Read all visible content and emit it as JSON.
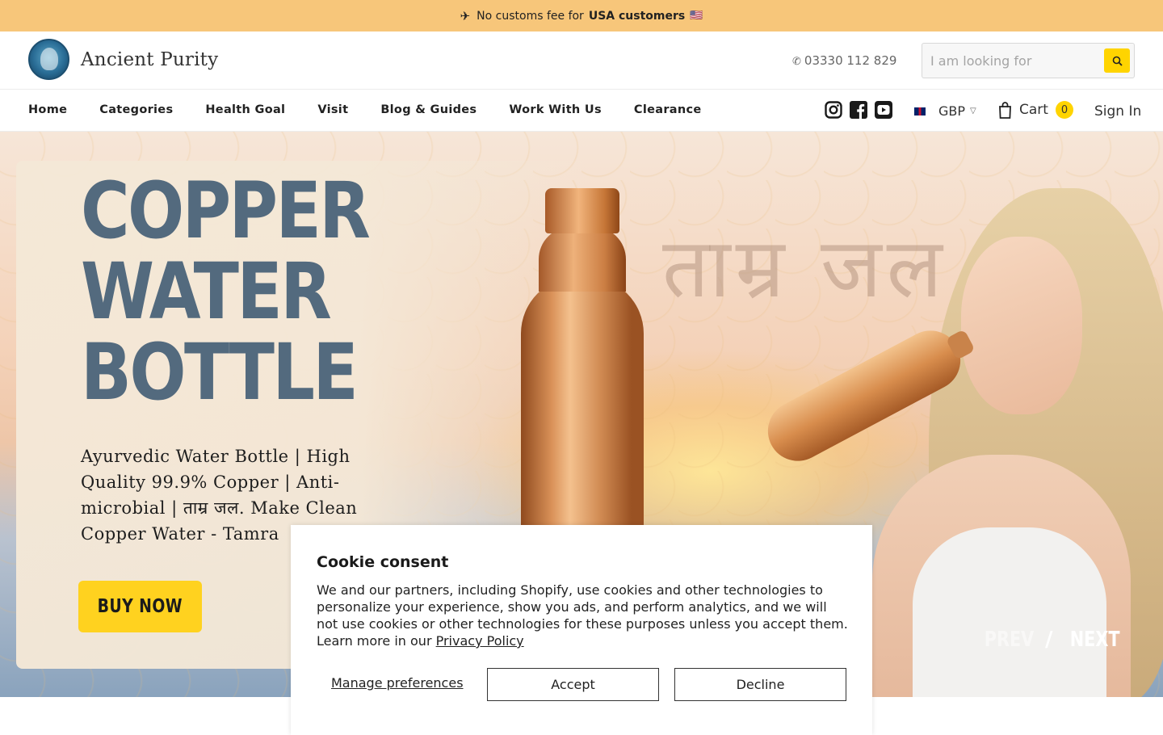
{
  "announcement": {
    "text": "No customs fee for",
    "emphasis": "USA customers",
    "flag": "🇺🇸",
    "icon": "plane-icon"
  },
  "header": {
    "logo_text": "Ancient Purity",
    "phone": "03330 112 829",
    "search_placeholder": "I am looking for"
  },
  "nav": {
    "items": [
      "Home",
      "Categories",
      "Health Goal",
      "Visit",
      "Blog & Guides",
      "Work With Us",
      "Clearance"
    ],
    "currency": "GBP",
    "cart_label": "Cart",
    "cart_count": "0",
    "signin": "Sign In"
  },
  "hero": {
    "title_line1": "COPPER",
    "title_line2": "WATER",
    "title_line3": "BOTTLE",
    "devanagari": "ताम्र जल",
    "subtitle": "Ayurvedic Water Bottle | High Quality 99.9% Copper | Anti-microbial | ताम्र जल. Make Clean Copper Water - Tamra",
    "buy_label": "BUY NOW",
    "prev_label": "PREV",
    "separator": "/",
    "next_label": "NEXT"
  },
  "cookie": {
    "title": "Cookie consent",
    "body": "We and our partners, including Shopify, use cookies and other technologies to personalize your experience, show you ads, and perform analytics, and we will not use cookies or other technologies for these purposes unless you accept them. Learn more in our",
    "link": "Privacy Policy",
    "manage": "Manage preferences",
    "accept": "Accept",
    "decline": "Decline"
  },
  "colors": {
    "announcement_bg": "#f7c67a",
    "accent_yellow": "#ffd400",
    "hero_title": "#536a7e"
  }
}
